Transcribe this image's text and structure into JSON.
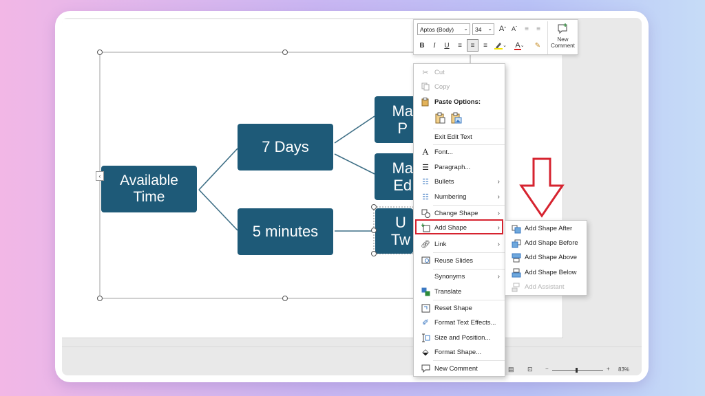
{
  "diagram": {
    "root": "Available\nTime",
    "branch1": "7 Days",
    "branch2": "5 minutes",
    "leaf1": "Ma\nP",
    "leaf2": "Ma\nEd",
    "leaf3": "U\nTw"
  },
  "mini_toolbar": {
    "font_name": "Aptos (Body)",
    "font_size": "34",
    "bold": "B",
    "italic": "I",
    "underline": "U",
    "grow_font": "A",
    "shrink_font": "A",
    "font_color": "A",
    "new_comment": "New\nComment"
  },
  "context_menu": {
    "items": [
      {
        "label": "Cut",
        "icon": "scissors-icon",
        "disabled": true
      },
      {
        "label": "Copy",
        "icon": "copy-icon",
        "disabled": true
      },
      {
        "label": "Paste Options:",
        "icon": "paste-icon"
      },
      {
        "label": "Exit Edit Text"
      },
      {
        "label": "Font...",
        "icon": "font-icon"
      },
      {
        "label": "Paragraph...",
        "icon": "paragraph-icon"
      },
      {
        "label": "Bullets",
        "icon": "bullets-icon",
        "submenu": true
      },
      {
        "label": "Numbering",
        "icon": "numbering-icon",
        "submenu": true
      },
      {
        "label": "Change Shape",
        "icon": "change-shape-icon",
        "submenu": true
      },
      {
        "label": "Add Shape",
        "icon": "add-shape-icon",
        "submenu": true,
        "highlighted": true
      },
      {
        "label": "Link",
        "icon": "link-icon",
        "submenu": true
      },
      {
        "label": "Reuse Slides",
        "icon": "reuse-slides-icon"
      },
      {
        "label": "Synonyms",
        "submenu": true
      },
      {
        "label": "Translate",
        "icon": "translate-icon"
      },
      {
        "label": "Reset Shape",
        "icon": "reset-shape-icon"
      },
      {
        "label": "Format Text Effects...",
        "icon": "text-effects-icon"
      },
      {
        "label": "Size and Position...",
        "icon": "size-position-icon"
      },
      {
        "label": "Format Shape...",
        "icon": "format-shape-icon"
      },
      {
        "label": "New Comment",
        "icon": "comment-icon"
      }
    ]
  },
  "submenu": {
    "items": [
      {
        "label": "Add Shape After",
        "icon": "add-after-icon"
      },
      {
        "label": "Add Shape Before",
        "icon": "add-before-icon"
      },
      {
        "label": "Add Shape Above",
        "icon": "add-above-icon"
      },
      {
        "label": "Add Shape Below",
        "icon": "add-below-icon"
      },
      {
        "label": "Add Assistant",
        "icon": "add-assistant-icon",
        "disabled": true
      }
    ]
  },
  "status": {
    "zoom": "83%",
    "zoom_minus": "−",
    "zoom_plus": "+"
  },
  "colors": {
    "shape_fill": "#1e5a78",
    "connector": "#3d6e85",
    "annotation_red": "#d6232f",
    "accent_blue": "#3b78c2"
  }
}
